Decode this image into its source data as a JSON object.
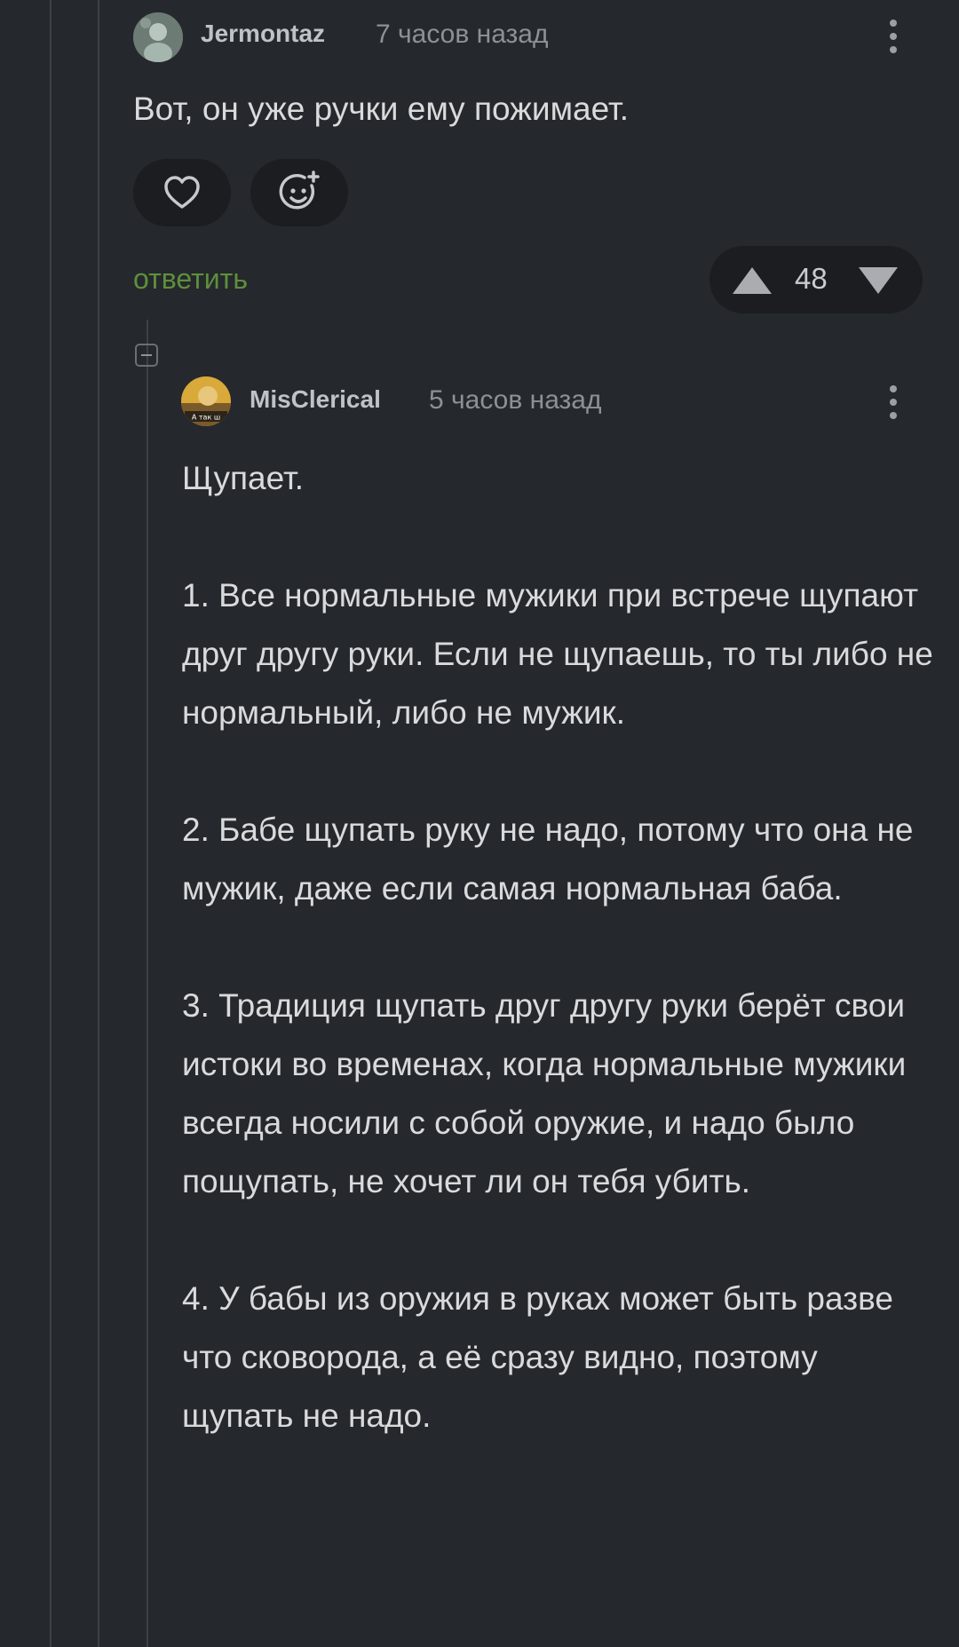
{
  "comment1": {
    "username": "Jermontaz",
    "time": "7 часов назад",
    "text": "Вот, он уже ручки ему пожимает.",
    "reply_label": "ответить",
    "rating": "48",
    "icons": [
      "heart-icon",
      "emoji-add-icon",
      "more-vertical-icon",
      "arrow-up-icon",
      "arrow-down-icon"
    ]
  },
  "comment2": {
    "username": "MisClerical",
    "avatar_caption": "А так ш",
    "time": "5 часов назад",
    "text": "Щупает.\n\n1. Все нормальные мужики при встрече щупают друг другу руки. Если не щупаешь, то ты либо не нормальный, либо не мужик.\n\n2. Бабе щупать руку не надо, потому что она не мужик, даже если самая нормальная баба.\n\n3. Традиция щупать друг другу руки берёт свои истоки во временах, когда нормальные мужики всегда носили с собой оружие, и надо было пощупать, не хочет ли он тебя убить.\n\n4. У бабы из оружия в руках может быть разве что сковорода, а её сразу видно, поэтому щупать не надо.",
    "icons": [
      "more-vertical-icon",
      "collapse-icon"
    ]
  },
  "colors": {
    "background": "#25282c",
    "pill": "#1b1d20",
    "reply": "#5e8f3c",
    "text": "#d9dadc",
    "muted": "#8d9196"
  }
}
